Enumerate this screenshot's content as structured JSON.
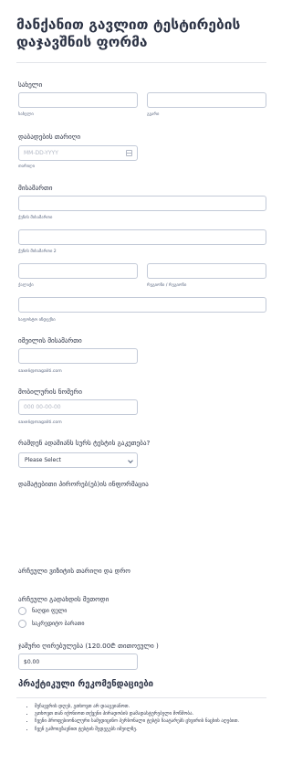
{
  "form": {
    "title": "მანქანით გავლით ტესტირების დაჯავშნის ფორმა",
    "name": {
      "label": "სახელი",
      "first_sub": "სახელი",
      "last_sub": "გვარი"
    },
    "birthdate": {
      "label": "დაბადების თარიღი",
      "placeholder": "MM-DD-YYYY",
      "sub": "თარიღი"
    },
    "address": {
      "label": "მისამართი",
      "street1": "ქუჩის მისამართი",
      "street2": "ქუჩის მისამართი 2",
      "city": "ქალაქი",
      "state": "რეგიონი / რეგიონი",
      "zip": "საფოსტო ინდექსი"
    },
    "email": {
      "label": "იმეილის მისამართი",
      "sub": "saxeli@magaliti.com"
    },
    "phone": {
      "label": "მობილურის ნომერი",
      "placeholder": "000 00-00-00",
      "sub": "saxeli@magaliti.com"
    },
    "people": {
      "label": "რამდენ ადამიანს სურს ტესტის გაკეთება?",
      "selected": "Please Select"
    },
    "info": {
      "label": "დამატებითი პირორებ(ებ)ის ინფორმაცია"
    },
    "datetime": {
      "label": "არჩეული ვიზიტის თარიღი და დრო"
    },
    "payment": {
      "label": "არჩეული გადახდის მეთოდი",
      "options": [
        "ნაღდი ფული",
        "საკრედიტო ბარათი"
      ]
    },
    "total": {
      "label": "ჯამური ღირებულება (120.00₾ თითოეული )",
      "value": "$0.00"
    },
    "recommendations": {
      "title": "პრაქტიკული რეკომენდაციები",
      "items": [
        "შეჩავვრის დღეს, გთხოვთ არ დააგვიანოთ.",
        "გთხოვთ თან იქონიოთ თქვენი პირადობის დამადასტურებელი მოწმობა.",
        "ჩვენი პროფესიონალური სამედიცინო პერსონალი ტესტს ჩაატარებს ცხვირის ნაცხის აღებით.",
        "ჩვენ გამოიგზავნით ტესტის შედეგებს იმეილზე."
      ]
    }
  }
}
